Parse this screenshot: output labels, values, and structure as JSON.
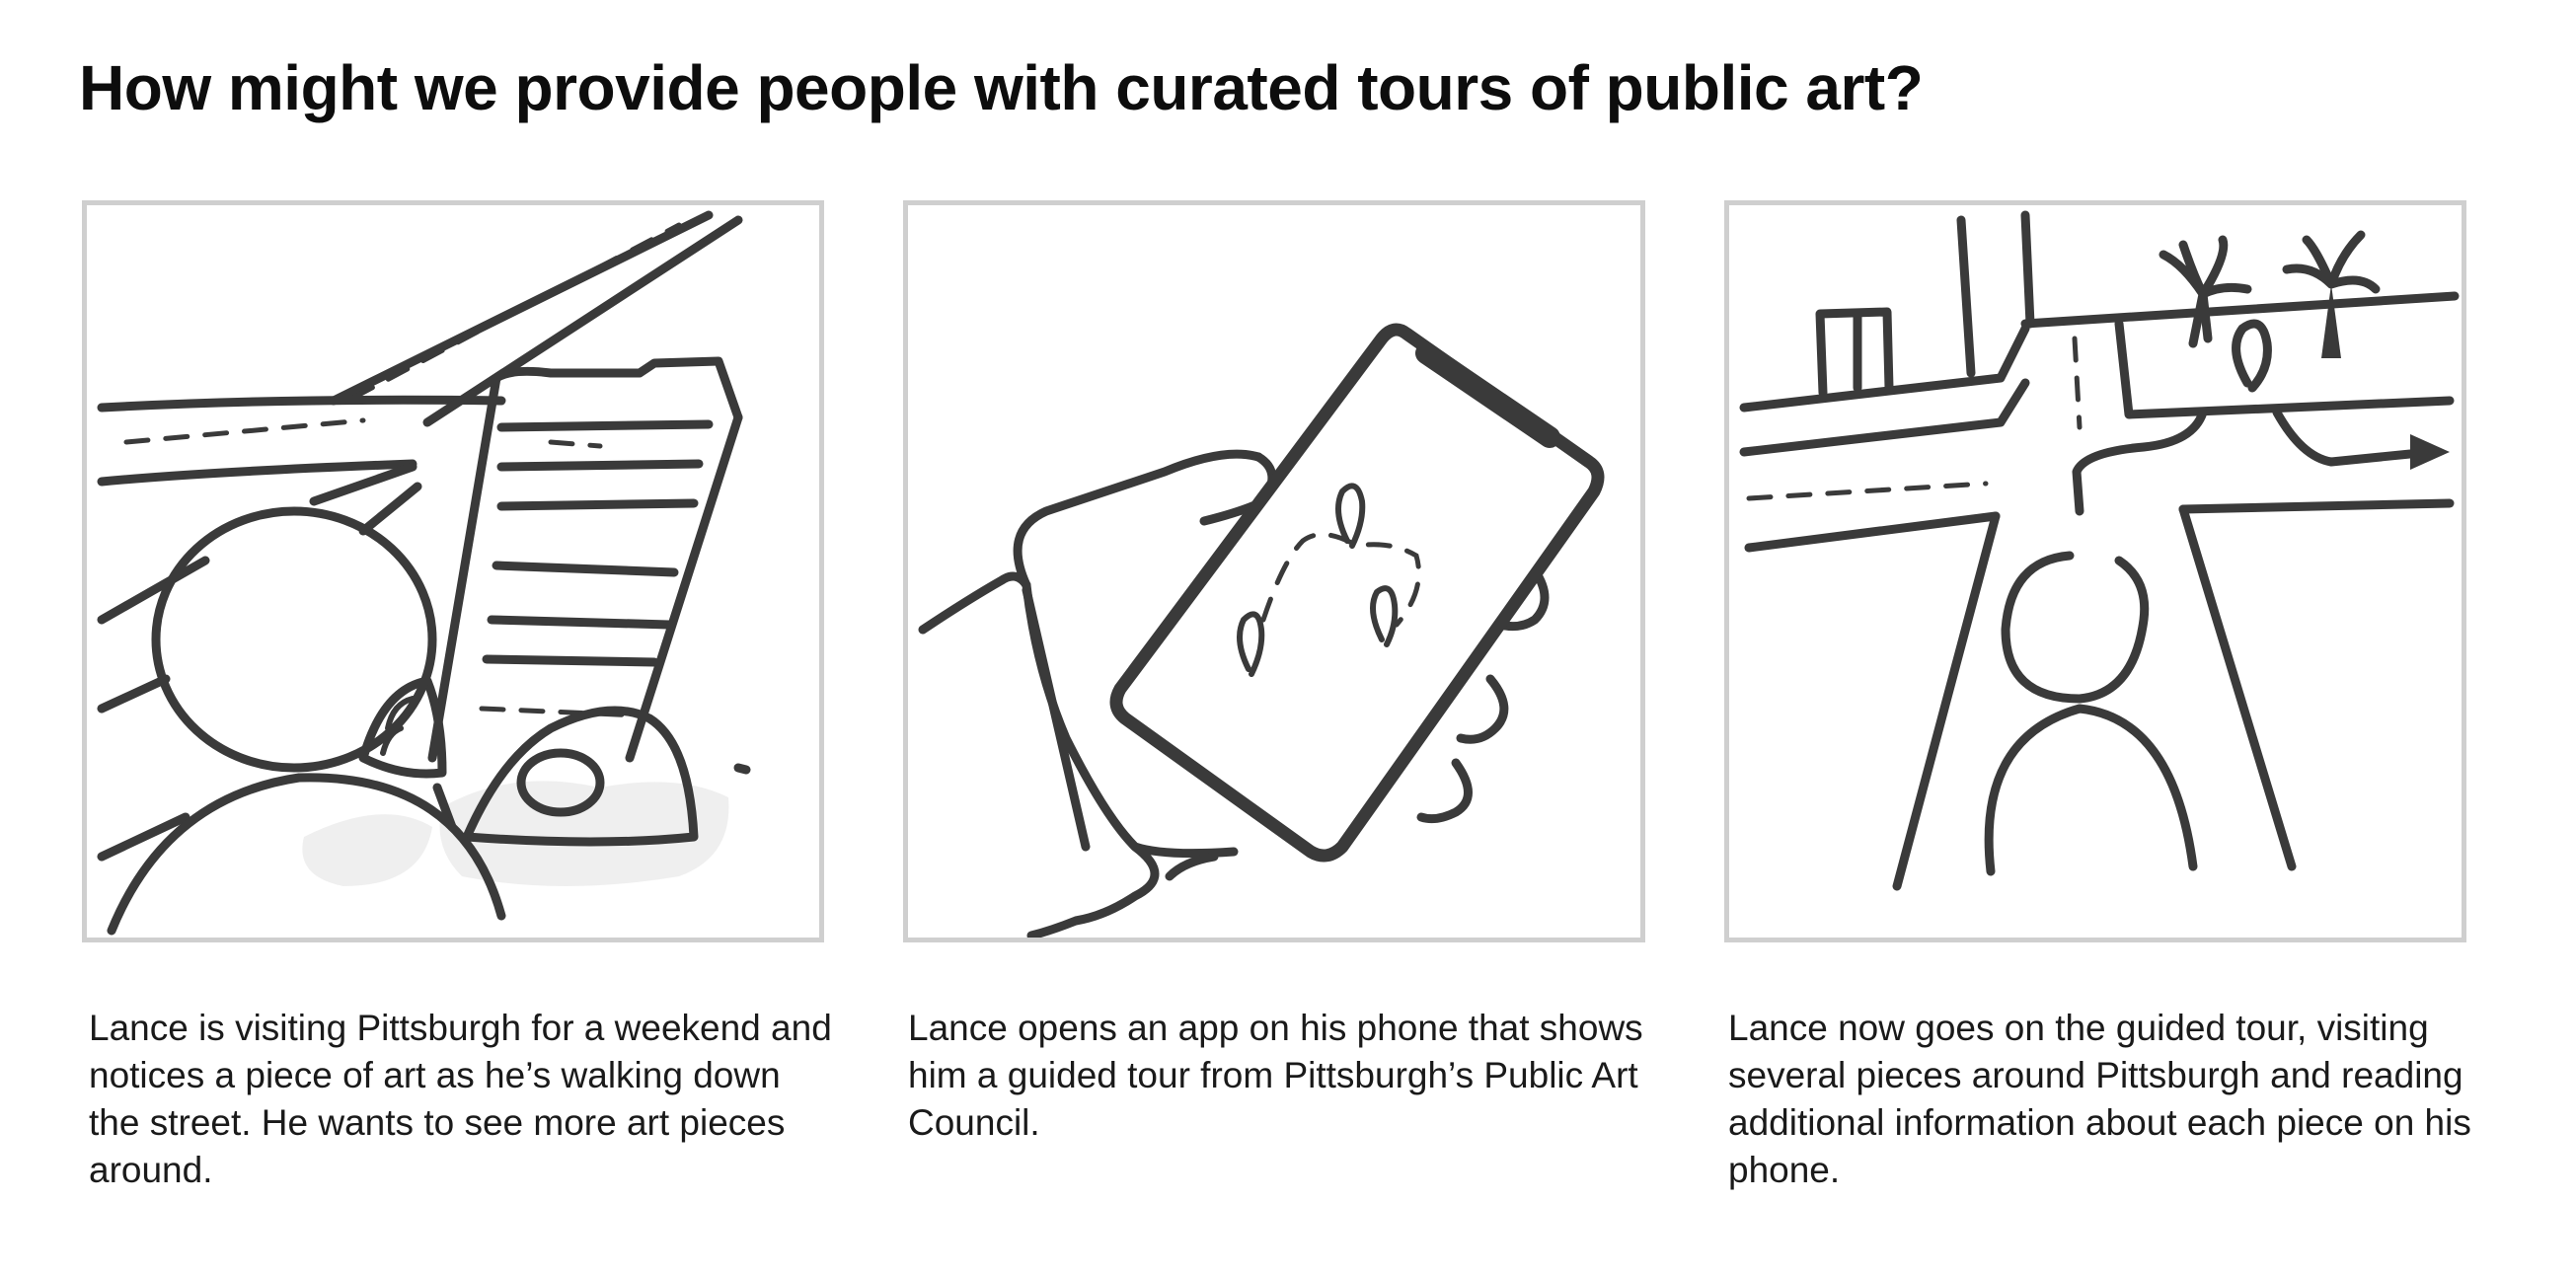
{
  "title": "How might we provide people with curated tours of public art?",
  "panels": [
    {
      "caption": "Lance is visiting Pittsburgh for a weekend and notices a piece of art as he’s walking down the street. He wants to see more art pieces around.",
      "icon": "person-on-street-sketch"
    },
    {
      "caption": "Lance opens an app on his phone that shows him a guided tour from Pittsburgh’s Public Art Council.",
      "icon": "hand-holding-phone-map-sketch"
    },
    {
      "caption": "Lance now goes on the guided tour, visiting several pieces around Pittsburgh and reading additional information about each piece on his phone.",
      "icon": "person-at-intersection-sketch"
    }
  ]
}
